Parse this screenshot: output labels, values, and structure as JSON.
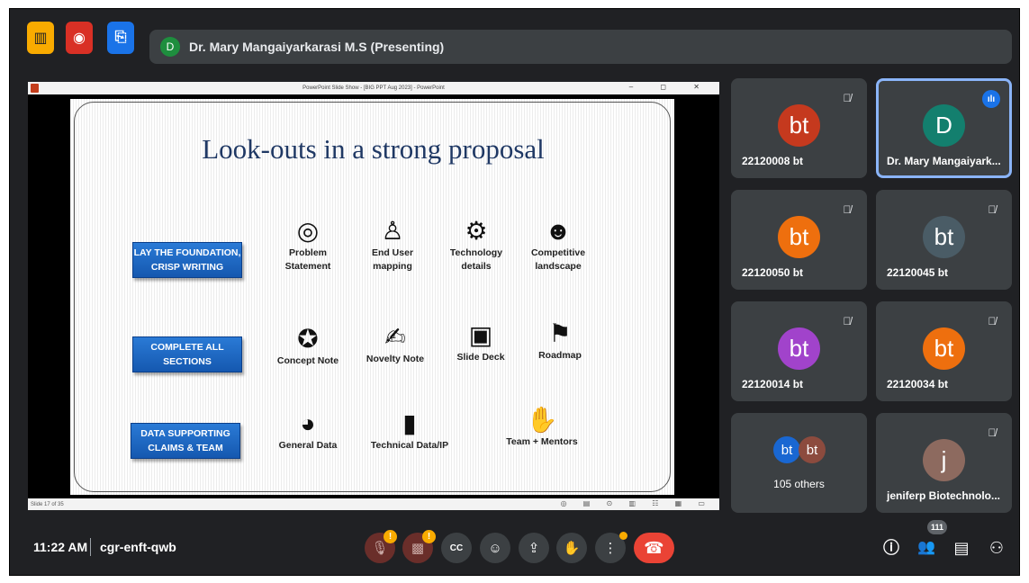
{
  "meeting": {
    "presenter_initial": "D",
    "presenting_text": "Dr. Mary Mangaiyarkarasi M.S (Presenting)",
    "time": "11:22 AM",
    "code": "cgr-enft-qwb",
    "participant_count": "111"
  },
  "ppt": {
    "window_title": "PowerPoint Slide Show - [BIG PPT Aug 2023] - PowerPoint",
    "window_controls": "– ◻ ✕",
    "status_left": "Slide 17 of 35",
    "status_right": "◎ ▤ ⊙ ▥ ☷ ▦ ▭"
  },
  "slide": {
    "title": "Look-outs in a strong proposal",
    "rows": [
      {
        "label": "LAY THE FOUNDATION, CRISP WRITING",
        "items": [
          {
            "icon": "target-icon",
            "glyph": "◎",
            "label": "Problem Statement"
          },
          {
            "icon": "user-icon",
            "glyph": "♙",
            "label": "End User mapping"
          },
          {
            "icon": "robot-icon",
            "glyph": "⚙",
            "label": "Technology details"
          },
          {
            "icon": "group-icon",
            "glyph": "☻",
            "label": "Competitive landscape"
          }
        ]
      },
      {
        "label": "COMPLETE ALL SECTIONS",
        "items": [
          {
            "icon": "head-icon",
            "glyph": "✪",
            "label": "Concept Note"
          },
          {
            "icon": "person-icon",
            "glyph": "✍",
            "label": "Novelty Note"
          },
          {
            "icon": "presentation-icon",
            "glyph": "▣",
            "label": "Slide Deck"
          },
          {
            "icon": "signpost-icon",
            "glyph": "⚑",
            "label": "Roadmap"
          }
        ]
      },
      {
        "label": "DATA SUPPORTING CLAIMS & TEAM",
        "items": [
          {
            "icon": "chart-board-icon",
            "glyph": "◕",
            "label": "General Data"
          },
          {
            "icon": "bar-chart-icon",
            "glyph": "▮",
            "label": "Technical Data/IP"
          },
          {
            "icon": "team-icon",
            "glyph": "✋",
            "label": "Team + Mentors"
          }
        ]
      }
    ]
  },
  "participants": [
    {
      "initials": "bt",
      "name": "22120008 bt",
      "color": "#c5391e",
      "muted": true
    },
    {
      "initials": "D",
      "name": "Dr. Mary Mangaiyark...",
      "color": "#137f6e",
      "speaking": true
    },
    {
      "initials": "bt",
      "name": "22120050 bt",
      "color": "#ee6f0e",
      "muted": true
    },
    {
      "initials": "bt",
      "name": "22120045 bt",
      "color": "#4a5c66",
      "muted": true
    },
    {
      "initials": "bt",
      "name": "22120014 bt",
      "color": "#a143cb",
      "muted": true
    },
    {
      "initials": "bt",
      "name": "22120034 bt",
      "color": "#ee6f0e",
      "muted": true
    },
    {
      "initials": "j",
      "name": "jeniferp Biotechnolo...",
      "color": "#8d6a5f",
      "muted": true
    }
  ],
  "others": {
    "count_label": "105 others",
    "av1": "bt",
    "av2": "bt",
    "av1_color": "#1967d2",
    "av2_color": "#8c4b3e"
  },
  "controls": {
    "mic": "🎙",
    "cam": "▩",
    "captions": "CC",
    "emoji": "☺",
    "present": "⇪",
    "hand": "✋",
    "more": "⋮",
    "hangup": "☎",
    "warn": "!",
    "info": "ⓘ",
    "people": "👥",
    "chat": "▤",
    "activities": "⚇"
  },
  "colors": {
    "top_btn_yellow": "#f9ab00",
    "top_btn_red": "#d93025",
    "top_btn_blue": "#1a73e8",
    "accent_blue": "#8ab4f8"
  }
}
